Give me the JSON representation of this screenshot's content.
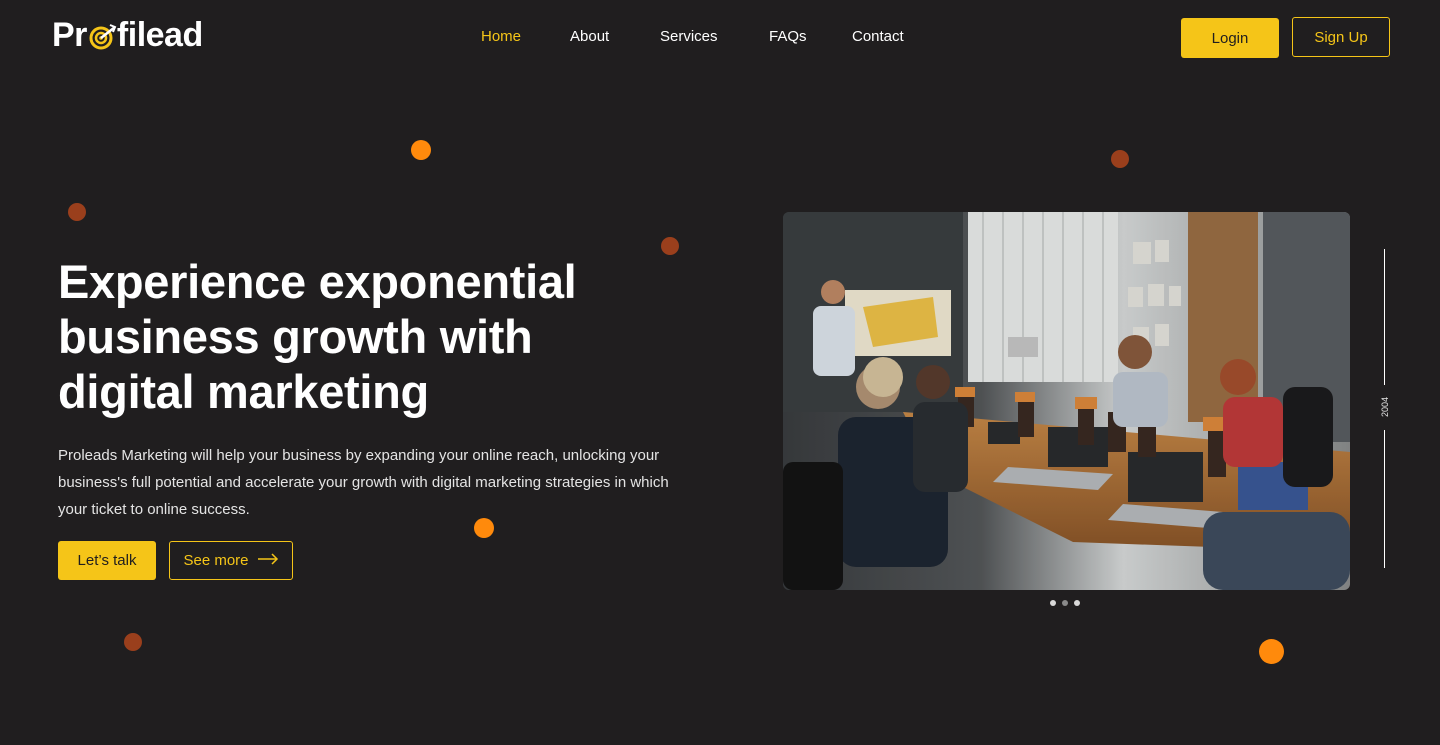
{
  "brand": {
    "logo_text_left": "Pr",
    "logo_text_right": "filead",
    "logo_icon": "target-arrow-icon",
    "accent": "#f5c518"
  },
  "nav": {
    "items": [
      {
        "label": "Home",
        "active": true
      },
      {
        "label": "About",
        "active": false
      },
      {
        "label": "Services",
        "active": false
      },
      {
        "label": "FAQs",
        "active": false
      },
      {
        "label": "Contact",
        "active": false
      }
    ]
  },
  "header": {
    "login_label": "Login",
    "signup_label": "Sign Up"
  },
  "hero": {
    "title": "Experience exponential business growth with digital marketing",
    "description": "Proleads Marketing will help your business by expanding your online reach, unlocking your business's full potential and accelerate your growth with digital marketing strategies in which your ticket to online success.",
    "primary_cta": "Let’s talk",
    "secondary_cta": "See more",
    "secondary_cta_icon": "arrow-right-icon"
  },
  "carousel": {
    "slide_count": 3,
    "active_index": 0
  },
  "year_label": "2004",
  "colors": {
    "background": "#201e1f",
    "accent": "#f5c518",
    "dot_orange": "#ff8a0c",
    "dot_brown": "#9a3f1c"
  }
}
